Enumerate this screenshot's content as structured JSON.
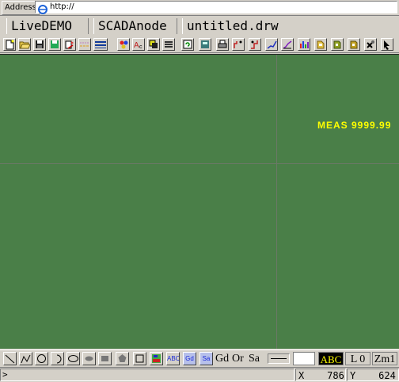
{
  "address": {
    "label": "Address",
    "url": "http://"
  },
  "title_segments": [
    "LiveDEMO",
    "SCADAnode",
    "untitled.drw"
  ],
  "toolbar_icons": [
    "new-file-icon",
    "open-folder-icon",
    "save-icon",
    "save-as-icon",
    "print-preview-icon",
    "line-style-icon",
    "line-width-icon",
    "color-palette-icon",
    "text-color-icon",
    "bring-front-icon",
    "layers-icon",
    "refresh-icon",
    "calculator-icon",
    "printer-icon",
    "align-left-icon",
    "align-right-icon",
    "chart-step-icon",
    "chart-line-icon",
    "bar-chart-icon",
    "pie-chart-icon",
    "database-icon",
    "cylinder-icon",
    "tools-icon",
    "help-pointer-icon"
  ],
  "canvas": {
    "background": "#4a7f48",
    "measurement_label": "MEAS  9999.99",
    "measurement_color": "#ffff00"
  },
  "draw_tools": {
    "icons": [
      "line-tool-icon",
      "polyline-tool-icon",
      "circle-tool-icon",
      "arc-tool-icon",
      "ellipse-tool-icon",
      "filled-ellipse-tool-icon",
      "filled-rect-tool-icon",
      "polygon-tool-icon",
      "rectangle-tool-icon",
      "symbol-tool-icon"
    ],
    "abc_button": "ABC",
    "gd_button": "Gd",
    "sa_button": "Sa",
    "gd_text": "Gd",
    "or_text": "Or",
    "sa_text": "Sa",
    "text_sample": "ABC",
    "layer": "L 0",
    "zoom": "Zm1"
  },
  "status": {
    "prompt": ">",
    "x_label": "X",
    "x_value": "786",
    "y_label": "Y",
    "y_value": "624"
  }
}
